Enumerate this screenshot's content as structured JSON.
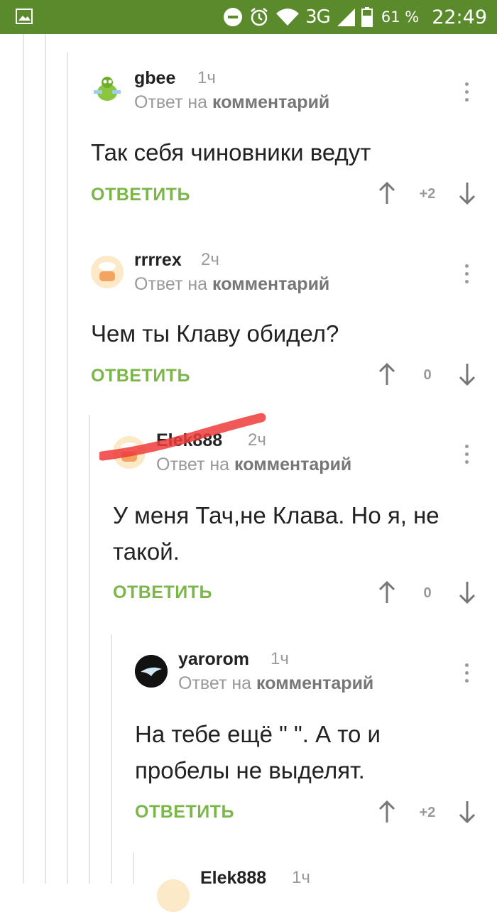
{
  "statusbar": {
    "network": "3G",
    "battery": "61 %",
    "time": "22:49"
  },
  "reply_label": "ОТВЕТИТЬ",
  "comments": [
    {
      "user": "gbee",
      "time": "1ч",
      "meta_prefix": "Ответ на",
      "meta_link": "комментарий",
      "lines": [
        "Так себя чиновники ведут"
      ],
      "votes": "+2"
    },
    {
      "user": "rrrrex",
      "time": "2ч",
      "meta_prefix": "Ответ на",
      "meta_link": "комментарий",
      "lines": [
        "Чем ты Клаву обидел?"
      ],
      "votes": "0"
    },
    {
      "user": "Elek888",
      "time": "2ч",
      "meta_prefix": "Ответ на",
      "meta_link": "комментарий",
      "lines": [
        "У меня Тач,не Клава. Но я, не",
        "такой."
      ],
      "votes": "0"
    },
    {
      "user": "yarorom",
      "time": "1ч",
      "meta_prefix": "Ответ на",
      "meta_link": "комментарий",
      "lines": [
        "На тебе ещё \" \". А то и",
        "пробелы не выделят."
      ],
      "votes": "+2"
    },
    {
      "user": "Elek888",
      "time": "1ч"
    }
  ]
}
